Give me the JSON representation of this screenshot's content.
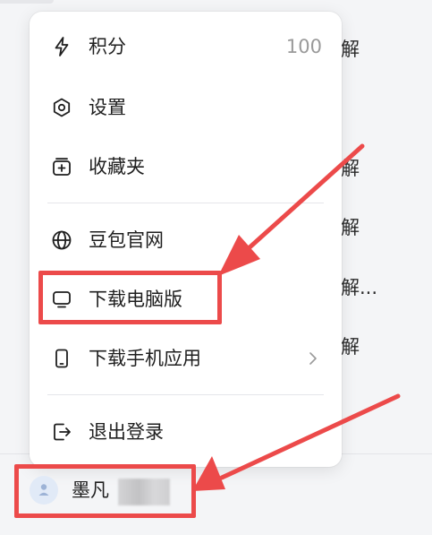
{
  "menu": {
    "points": {
      "label": "积分",
      "value": "100",
      "icon": "lightning-icon"
    },
    "settings": {
      "label": "设置",
      "icon": "gear-icon"
    },
    "favorites": {
      "label": "收藏夹",
      "icon": "folder-plus-icon"
    },
    "website": {
      "label": "豆包官网",
      "icon": "globe-icon"
    },
    "desktop": {
      "label": "下载电脑版",
      "icon": "monitor-icon"
    },
    "mobile": {
      "label": "下载手机应用",
      "icon": "phone-icon"
    },
    "logout": {
      "label": "退出登录",
      "icon": "logout-icon"
    }
  },
  "background": {
    "snippets": [
      "解",
      "解",
      "解",
      "解...",
      "解"
    ]
  },
  "user": {
    "name": "墨凡",
    "avatar_icon": "user-avatar-icon"
  },
  "colors": {
    "annotation": "#ec4a4a",
    "menu_bg": "#ffffff",
    "page_bg": "#f4f5f7",
    "muted_text": "#9a9a9a"
  }
}
